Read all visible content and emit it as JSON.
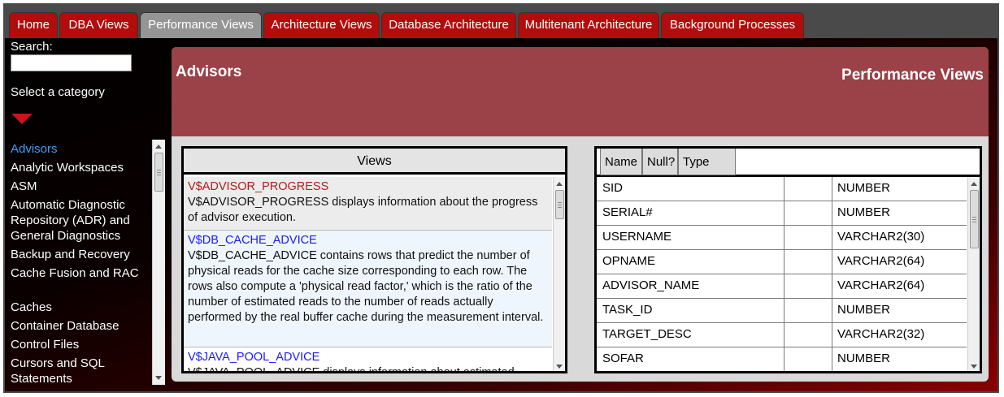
{
  "tabs": [
    {
      "label": "Home",
      "active": false
    },
    {
      "label": "DBA Views",
      "active": false
    },
    {
      "label": "Performance Views",
      "active": true
    },
    {
      "label": "Architecture Views",
      "active": false
    },
    {
      "label": "Database Architecture",
      "active": false
    },
    {
      "label": "Multitenant Architecture",
      "active": false
    },
    {
      "label": "Background Processes",
      "active": false
    }
  ],
  "sidebar": {
    "search_label": "Search:",
    "search_value": "",
    "category_label": "Select a category",
    "categories": [
      {
        "label": "Advisors",
        "selected": true
      },
      {
        "label": "Analytic Workspaces",
        "selected": false
      },
      {
        "label": "ASM",
        "selected": false
      },
      {
        "label": "Automatic Diagnostic Repository (ADR) and General Diagnostics",
        "selected": false
      },
      {
        "label": "Backup and Recovery",
        "selected": false
      },
      {
        "label": "Cache Fusion and RAC",
        "selected": false
      },
      {
        "label": "Caches",
        "selected": false
      },
      {
        "label": "Container Database",
        "selected": false
      },
      {
        "label": "Control Files",
        "selected": false
      },
      {
        "label": "Cursors and SQL Statements",
        "selected": false
      }
    ]
  },
  "main": {
    "title": "Advisors",
    "section": "Performance Views",
    "views_header": "Views",
    "views": [
      {
        "name": "V$ADVISOR_PROGRESS",
        "description": "V$ADVISOR_PROGRESS displays information about the progress of advisor execution.",
        "selected": true
      },
      {
        "name": "V$DB_CACHE_ADVICE",
        "description": "V$DB_CACHE_ADVICE contains rows that predict the number of physical reads for the cache size corresponding to each row. The rows also compute a 'physical read factor,' which is the ratio of the number of estimated reads to the number of reads actually performed by the real buffer cache during the measurement interval.",
        "selected": false
      },
      {
        "name": "V$JAVA_POOL_ADVICE",
        "description": "V$JAVA_POOL_ADVICE displays information about estimated",
        "selected": false
      }
    ],
    "columns_headers": {
      "name": "Name",
      "null": "Null?",
      "type": "Type"
    },
    "columns": [
      {
        "name": "SID",
        "null": "",
        "type": "NUMBER"
      },
      {
        "name": "SERIAL#",
        "null": "",
        "type": "NUMBER"
      },
      {
        "name": "USERNAME",
        "null": "",
        "type": "VARCHAR2(30)"
      },
      {
        "name": "OPNAME",
        "null": "",
        "type": "VARCHAR2(64)"
      },
      {
        "name": "ADVISOR_NAME",
        "null": "",
        "type": "VARCHAR2(64)"
      },
      {
        "name": "TASK_ID",
        "null": "",
        "type": "NUMBER"
      },
      {
        "name": "TARGET_DESC",
        "null": "",
        "type": "VARCHAR2(32)"
      },
      {
        "name": "SOFAR",
        "null": "",
        "type": "NUMBER"
      }
    ]
  },
  "colors": {
    "tab_bg": "#b30c0c",
    "tab_active_bg": "#959595",
    "header_bg": "#9b4148",
    "selected_view_name": "#b31b1b",
    "view_name": "#1a1aff",
    "selected_category": "#3aa0ff"
  }
}
